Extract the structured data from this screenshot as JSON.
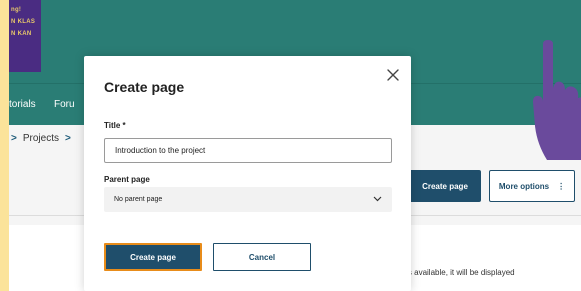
{
  "logo": {
    "lines": [
      "ng!",
      "N KLAS",
      "N KAN"
    ]
  },
  "nav": {
    "items": [
      "torials",
      "Foru"
    ]
  },
  "breadcrumb": {
    "sep": ">",
    "item": "Projects"
  },
  "page_actions": {
    "create_label": "Create page",
    "more_label": "More options",
    "more_icon": "⋮"
  },
  "background_text": "ge is available, it will be displayed",
  "modal": {
    "title": "Create page",
    "close_icon": "close-icon",
    "title_label": "Title *",
    "title_value": "Introduction to the project",
    "parent_label": "Parent page",
    "parent_value": "No parent page",
    "create_button": "Create page",
    "cancel_button": "Cancel"
  },
  "colors": {
    "header": "#2a7d75",
    "logo": "#4a2c82",
    "primary": "#1f4e6b",
    "focus": "#e88c1a",
    "frame": "#fbe39a",
    "hand": "#6a4a9c"
  }
}
